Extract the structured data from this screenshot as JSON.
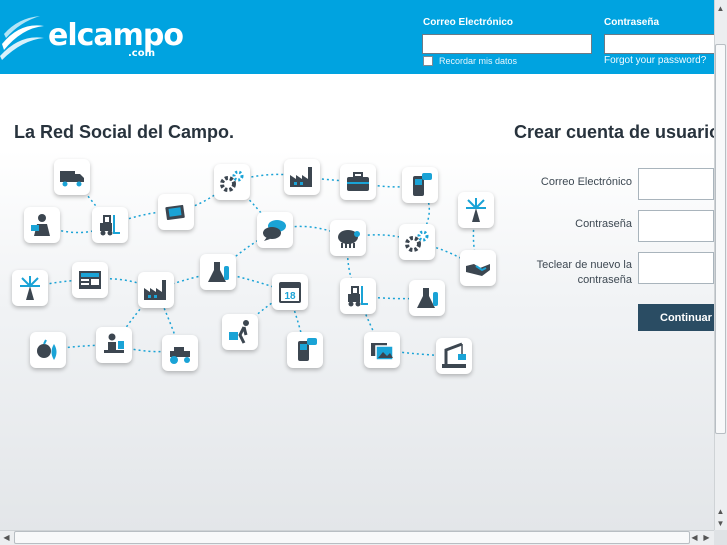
{
  "header": {
    "logo_text": "elcampo",
    "logo_sub": ".com",
    "email_label": "Correo Electrónico",
    "password_label": "Contraseña",
    "remember_label": "Recordar mis datos",
    "forgot_link": "Forgot your password?"
  },
  "main": {
    "tagline": "La Red Social del Campo.",
    "network_icons": [
      "truck-icon",
      "gear-icon",
      "factory-icon",
      "briefcase-icon",
      "phone-icon",
      "windmill-icon",
      "person-laptop-icon",
      "forklift-icon",
      "tablet-icon",
      "chat-icon",
      "sheep-icon",
      "handshake-icon",
      "newspaper-icon",
      "flask-icon",
      "calendar-icon",
      "fruit-icon",
      "person-desk-icon",
      "tractor-icon",
      "hand-truck-icon",
      "photo-icon",
      "crane-icon"
    ],
    "calendar_day": "18"
  },
  "signup": {
    "title": "Crear cuenta de usuario",
    "email_label": "Correo Electrónico",
    "password_label": "Contraseña",
    "confirm_label_line1": "Teclear de nuevo la",
    "confirm_label_line2": "contraseña",
    "submit_label": "Continuar"
  },
  "colors": {
    "header_bg": "#00a3e0",
    "button_bg": "#2a4c63",
    "icon_accent": "#1aa3d6",
    "icon_dark": "#3c4650"
  }
}
